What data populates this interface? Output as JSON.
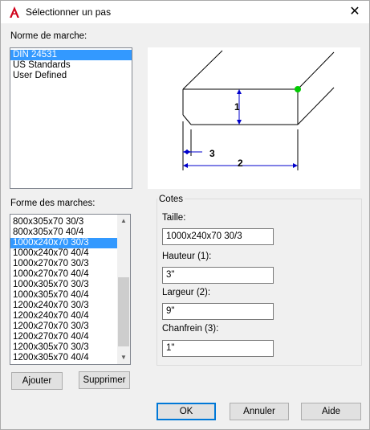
{
  "window": {
    "title": "Sélectionner un pas",
    "close_glyph": "✕"
  },
  "standard": {
    "label": "Norme de marche:",
    "items": [
      "DIN 24531",
      "US Standards",
      "User Defined"
    ],
    "selected_index": 0
  },
  "shapes": {
    "label": "Forme des marches:",
    "items": [
      "800x305x70 30/3",
      "800x305x70 40/4",
      "1000x240x70 30/3",
      "1000x240x70 40/4",
      "1000x270x70 30/3",
      "1000x270x70 40/4",
      "1000x305x70 30/3",
      "1000x305x70 40/4",
      "1200x240x70 30/3",
      "1200x240x70 40/4",
      "1200x270x70 30/3",
      "1200x270x70 40/4",
      "1200x305x70 30/3",
      "1200x305x70 40/4"
    ],
    "selected_index": 2
  },
  "preview": {
    "dim1": "1",
    "dim2": "2",
    "dim3": "3",
    "marker_color": "#00cc00",
    "dim_color": "#0000cc"
  },
  "dimensions": {
    "legend": "Cotes",
    "size_label": "Taille:",
    "size_value": "1000x240x70 30/3",
    "height_label": "Hauteur (1):",
    "height_value": "3\"",
    "width_label": "Largeur (2):",
    "width_value": "9\"",
    "chamfer_label": "Chanfrein (3):",
    "chamfer_value": "1\""
  },
  "buttons": {
    "add": "Ajouter",
    "remove": "Supprimer",
    "ok": "OK",
    "cancel": "Annuler",
    "help": "Aide"
  }
}
